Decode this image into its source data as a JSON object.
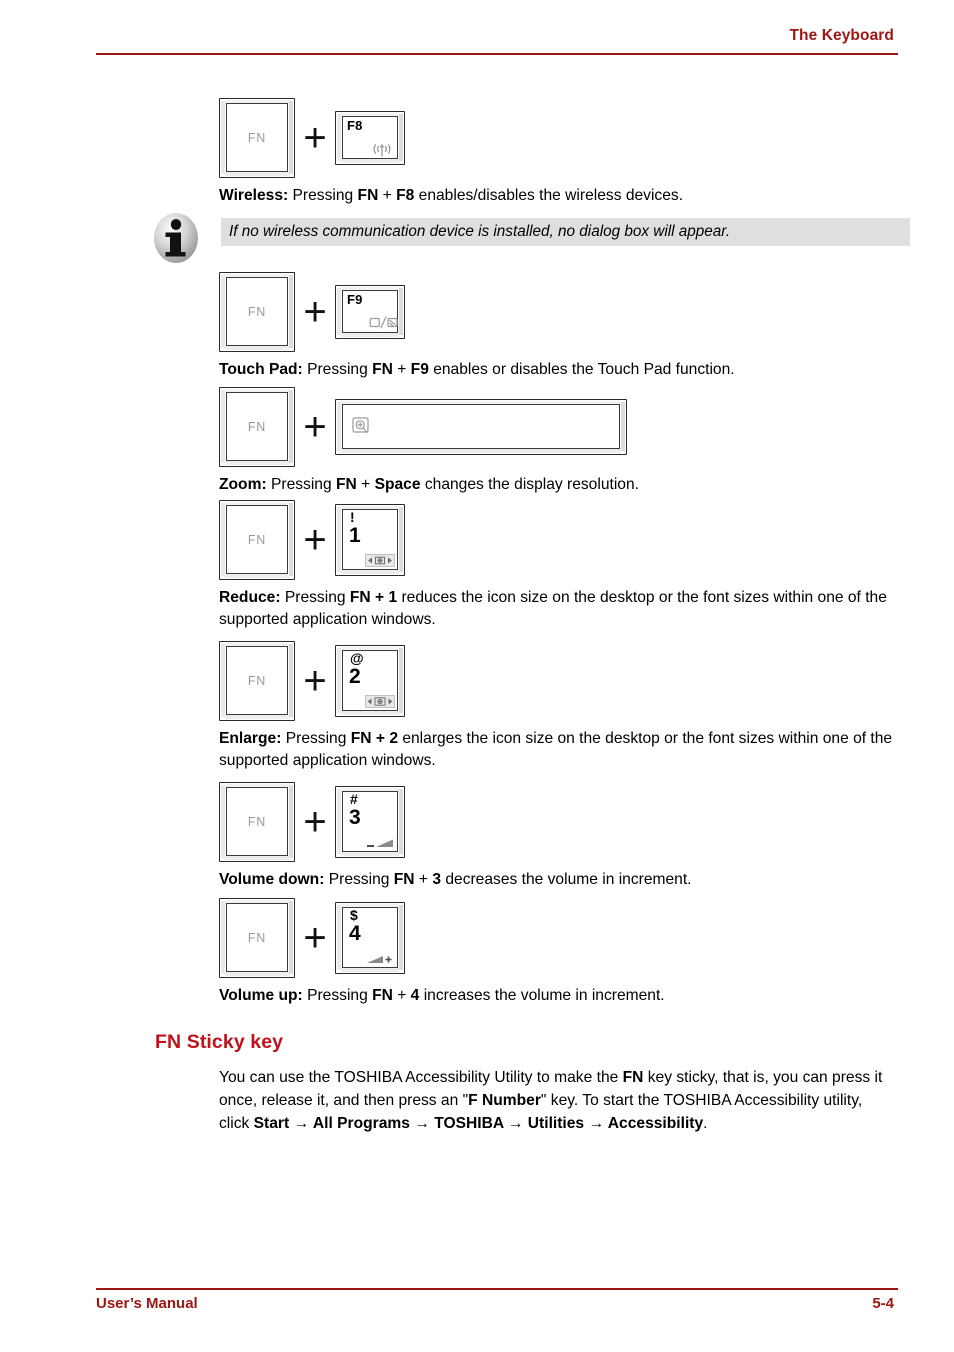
{
  "header": {
    "title": "The Keyboard"
  },
  "footer": {
    "left": "User’s Manual",
    "page": "5-4"
  },
  "colors": {
    "accent_red": "#9e1511",
    "heading_red": "#c1121c",
    "note_background": "#dfdfdf",
    "key_label_gray": "#9a9a9a"
  },
  "shortcuts": [
    {
      "id": "wireless",
      "fn_label": "FN",
      "plus": "+",
      "key_type": "fkey",
      "key_label": "F8",
      "key_icon": "wireless-antenna-icon",
      "caption_bold_lead": "Wireless:",
      "caption_part1": " Pressing ",
      "caption_kb1": "FN",
      "caption_mid": " + ",
      "caption_kb2": "F8",
      "caption_part2": " enables/disables the wireless devices."
    },
    {
      "id": "touchpad",
      "fn_label": "FN",
      "plus": "+",
      "key_type": "fkey",
      "key_label": "F9",
      "key_icon": "touchpad-toggle-icon",
      "caption_bold_lead": "Touch Pad:",
      "caption_part1": " Pressing ",
      "caption_kb1": "FN",
      "caption_mid": " + ",
      "caption_kb2": "F9",
      "caption_part2": " enables or disables the Touch Pad function."
    },
    {
      "id": "zoom",
      "fn_label": "FN",
      "plus": "+",
      "key_type": "space",
      "key_label": "",
      "key_icon": "magnifier-zoom-icon",
      "caption_bold_lead": "Zoom:",
      "caption_part1": " Pressing ",
      "caption_kb1": "FN",
      "caption_mid": " + ",
      "caption_kb2": "Space",
      "caption_part2": " changes the display resolution."
    },
    {
      "id": "reduce",
      "fn_label": "FN",
      "plus": "+",
      "key_type": "num",
      "key_top": "!",
      "key_label": "1",
      "key_icon": "reduce-icon",
      "caption_bold_lead": "Reduce:",
      "caption_part1": " Pressing ",
      "caption_kb1": "FN",
      "caption_mid": " + ",
      "caption_kb2": "1",
      "caption_part2": " reduces the icon size on the desktop or the font sizes within one of the supported application windows."
    },
    {
      "id": "enlarge",
      "fn_label": "FN",
      "plus": "+",
      "key_type": "num",
      "key_top": "@",
      "key_label": "2",
      "key_icon": "enlarge-icon",
      "caption_bold_lead": "Enlarge:",
      "caption_part1": " Pressing ",
      "caption_kb1": "FN",
      "caption_mid": " + ",
      "caption_kb2": "2",
      "caption_part2": " enlarges the icon size on the desktop or the font sizes within one of the supported application windows."
    },
    {
      "id": "volume-down",
      "fn_label": "FN",
      "plus": "+",
      "key_type": "num",
      "key_top": "#",
      "key_label": "3",
      "key_icon": "volume-down-icon",
      "caption_bold_lead": "Volume down:",
      "caption_part1": " Pressing ",
      "caption_kb1": "FN",
      "caption_mid": " + ",
      "caption_kb2": "3",
      "caption_part2": " decreases the volume in increment."
    },
    {
      "id": "volume-up",
      "fn_label": "FN",
      "plus": "+",
      "key_type": "num",
      "key_top": "$",
      "key_label": "4",
      "key_icon": "volume-up-icon",
      "caption_bold_lead": "Volume up:",
      "caption_part1": " Pressing ",
      "caption_kb1": "FN",
      "caption_mid": " + ",
      "caption_kb2": "4",
      "caption_part2": " increases the volume in increment."
    }
  ],
  "note": {
    "icon": "info-icon",
    "text": "If no wireless communication device is installed, no dialog box will appear."
  },
  "section": {
    "heading": "FN Sticky key",
    "p1_a": "You can use the TOSHIBA Accessibility Utility to make the ",
    "p1_fn": "FN",
    "p1_b": " key sticky, that is, you can press it once, release it, and then press an \"",
    "p1_fnum": "F Number",
    "p1_c": "\" key. To start the TOSHIBA Accessibility utility, click ",
    "p1_start": "Start",
    "arrow1": " → ",
    "p1_allprograms": "All Programs",
    "arrow2": " → ",
    "p1_toshiba": "TOSHIBA",
    "arrow3": " → ",
    "p1_utilities": "Utilities",
    "arrow4": " → ",
    "p1_accessibility": "Accessibility",
    "p1_end": "."
  }
}
